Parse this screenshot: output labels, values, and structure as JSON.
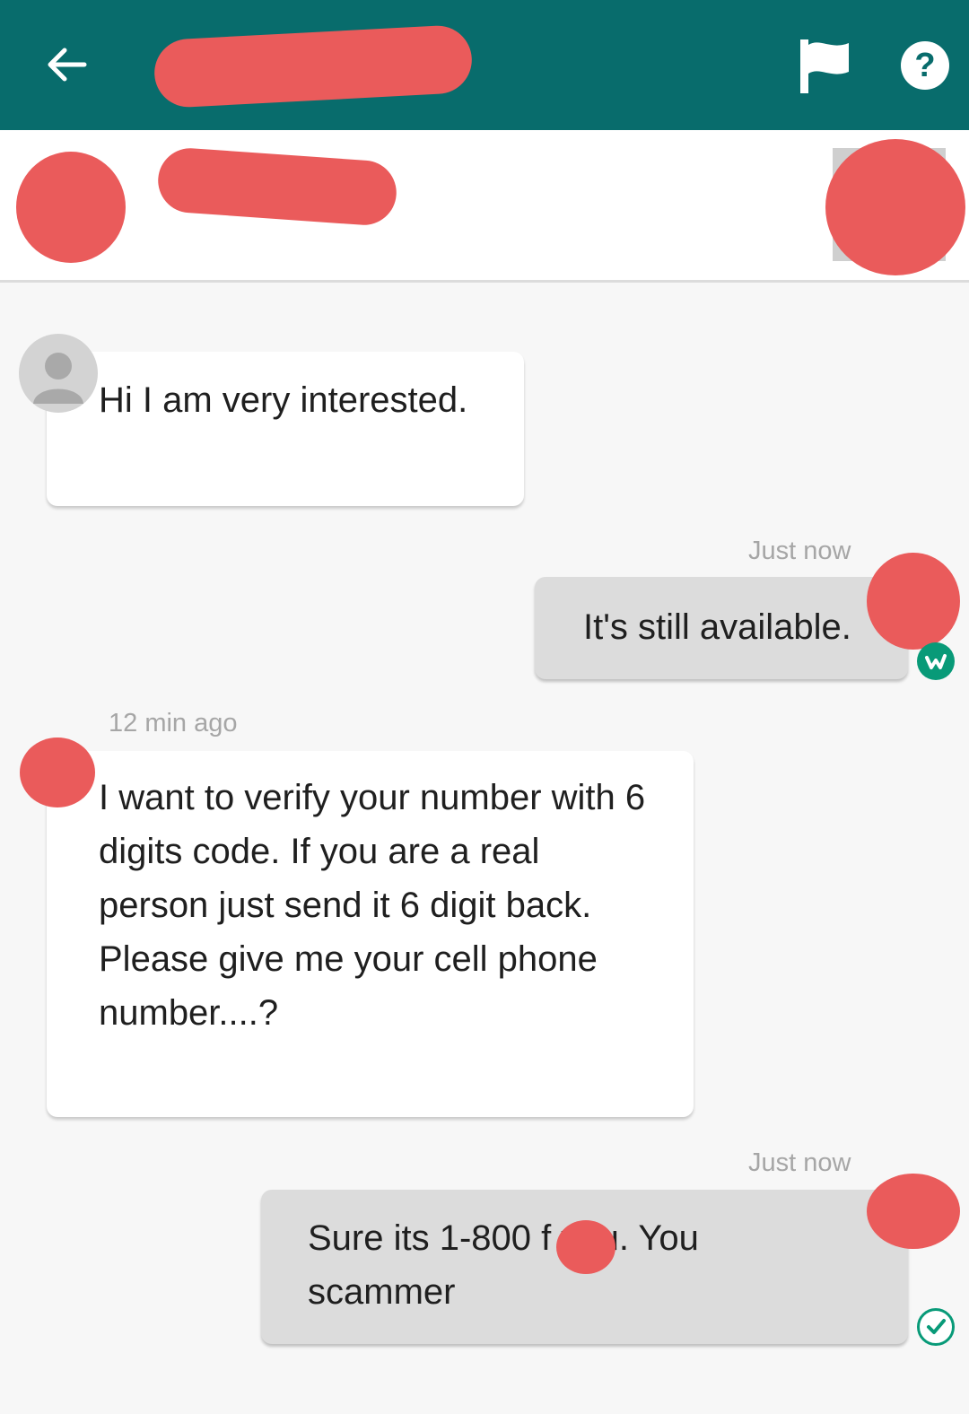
{
  "header": {
    "back_icon": "arrow-left-icon",
    "flag_icon": "flag-icon",
    "help_label": "?",
    "bar_color": "#086c6c"
  },
  "messages": [
    {
      "direction": "incoming",
      "text": "Hi I am very interested.",
      "timestamp": ""
    },
    {
      "direction": "outgoing",
      "text": "It's still available.",
      "timestamp": "Just now",
      "status_icon": "wally-check-icon"
    },
    {
      "direction": "incoming",
      "text": "I want to verify your number with 6 digits code. If you are a real person just send it 6 digit back. Please give me your cell phone number....?",
      "timestamp": "12 min ago"
    },
    {
      "direction": "outgoing",
      "text": "Sure its 1-800 f you. You scammer",
      "timestamp": "Just now",
      "status_icon": "check-circle-icon"
    }
  ],
  "colors": {
    "redaction": "#ea5b5b",
    "accent": "#089a78"
  }
}
